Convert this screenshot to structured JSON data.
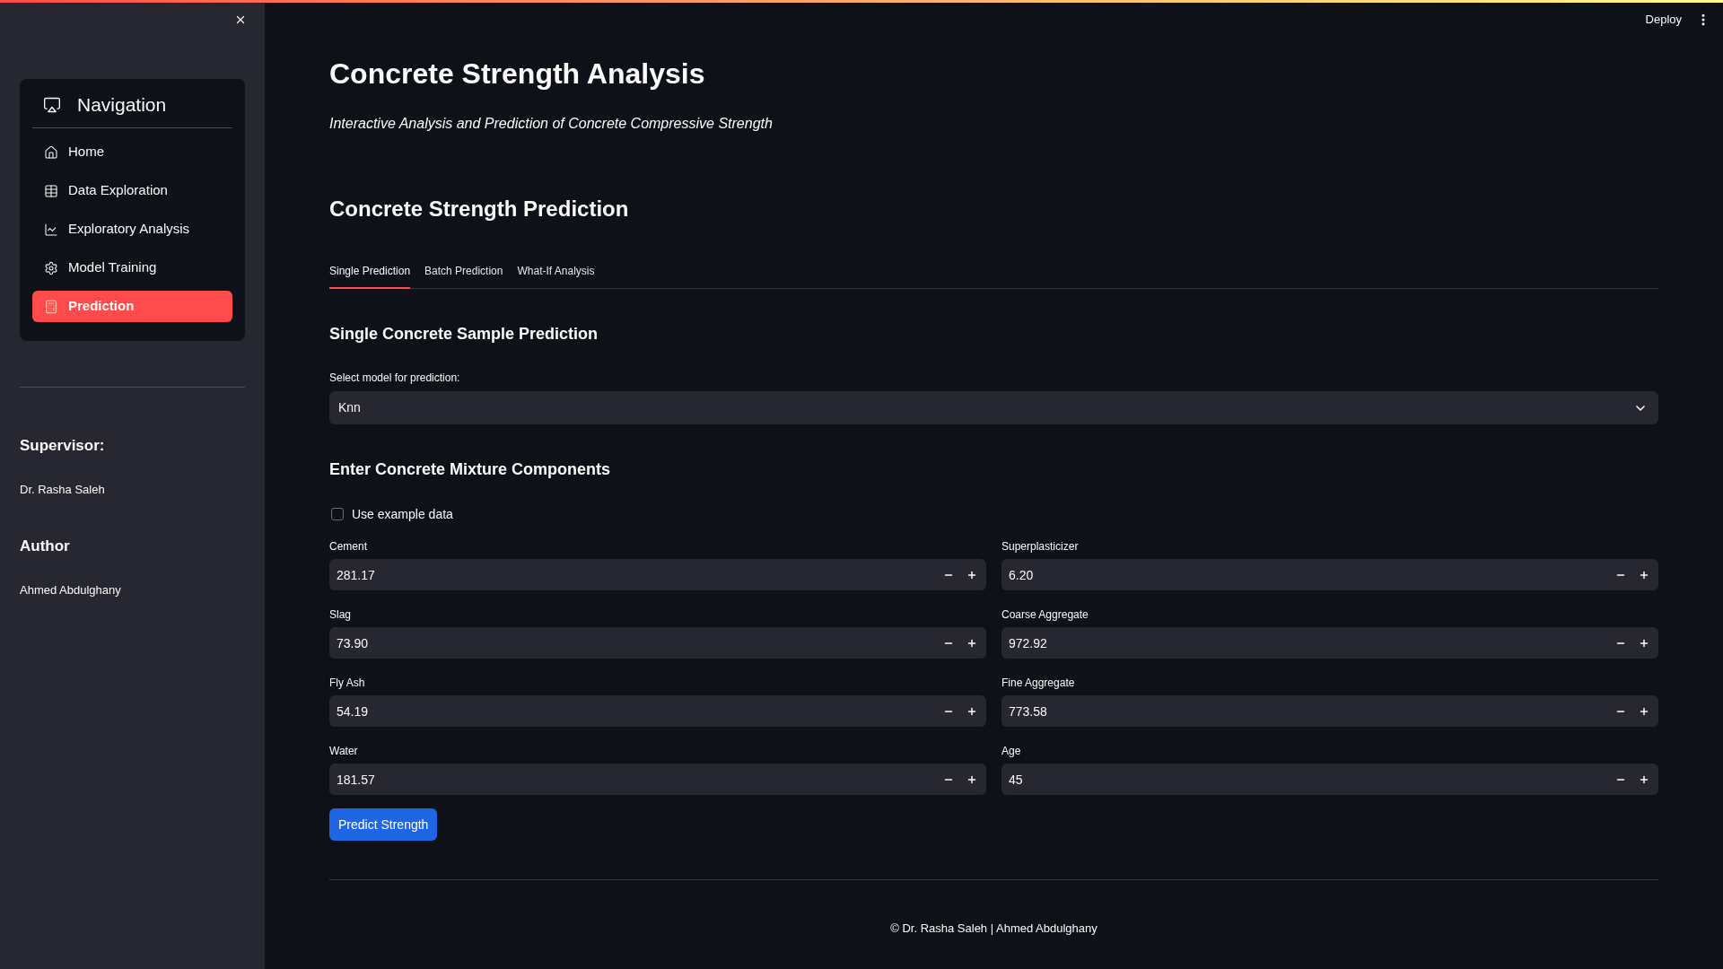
{
  "toolbar": {
    "deploy": "Deploy"
  },
  "sidebar": {
    "navigation": {
      "title": "Navigation",
      "items": [
        {
          "label": "Home",
          "selected": false
        },
        {
          "label": "Data Exploration",
          "selected": false
        },
        {
          "label": "Exploratory Analysis",
          "selected": false
        },
        {
          "label": "Model Training",
          "selected": false
        },
        {
          "label": "Prediction",
          "selected": true
        }
      ]
    },
    "credits": [
      {
        "heading": "Supervisor:",
        "name": "Dr. Rasha Saleh"
      },
      {
        "heading": "Author",
        "name": "Ahmed Abdulghany"
      }
    ]
  },
  "main": {
    "title": "Concrete Strength Analysis",
    "subtitle": "Interactive Analysis and Prediction of Concrete Compressive Strength",
    "section_title": "Concrete Strength Prediction",
    "tabs": [
      {
        "label": "Single Prediction",
        "selected": true
      },
      {
        "label": "Batch Prediction",
        "selected": false
      },
      {
        "label": "What-If Analysis",
        "selected": false
      }
    ],
    "panel": {
      "title": "Single Concrete Sample Prediction",
      "model_select": {
        "label": "Select model for prediction:",
        "value": "Knn"
      },
      "mixture_title": "Enter Concrete Mixture Components",
      "example_checkbox": {
        "label": "Use example data",
        "checked": false
      },
      "input_columns": [
        [
          {
            "label": "Cement",
            "value": "281.17"
          },
          {
            "label": "Slag",
            "value": "73.90"
          },
          {
            "label": "Fly Ash",
            "value": "54.19"
          },
          {
            "label": "Water",
            "value": "181.57"
          }
        ],
        [
          {
            "label": "Superplasticizer",
            "value": "6.20"
          },
          {
            "label": "Coarse Aggregate",
            "value": "972.92"
          },
          {
            "label": "Fine Aggregate",
            "value": "773.58"
          },
          {
            "label": "Age",
            "value": "45"
          }
        ]
      ],
      "submit_button": "Predict Strength"
    },
    "footer": "© Dr. Rasha Saleh | Ahmed Abdulghany"
  }
}
